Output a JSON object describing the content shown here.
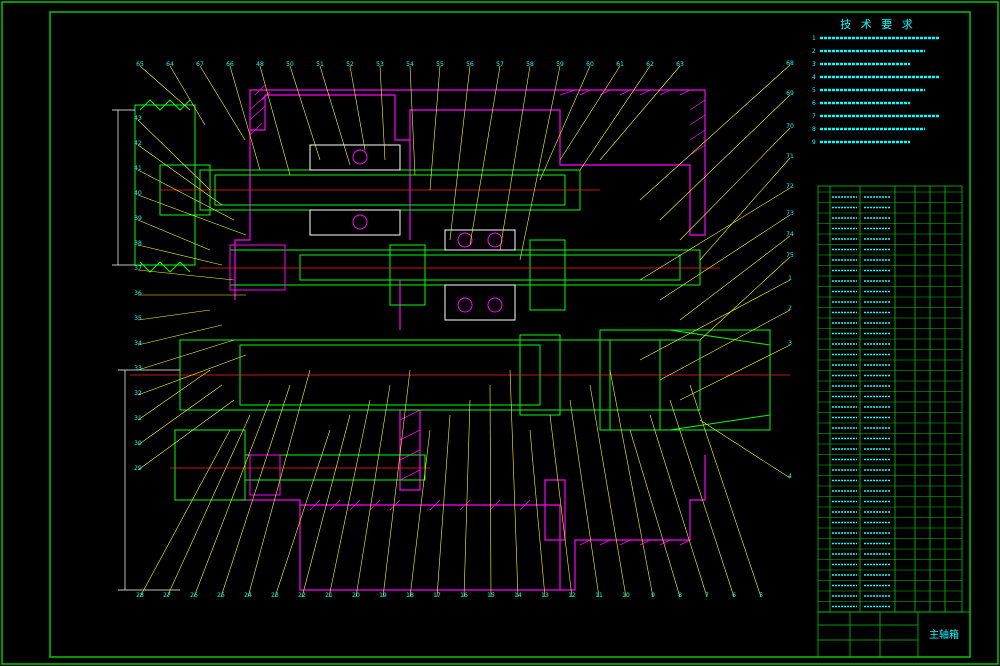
{
  "title_block": {
    "drawing_title": "主轴箱"
  },
  "notes": {
    "heading": "技 术 要 求",
    "items": [
      {
        "num": "1"
      },
      {
        "num": "2"
      },
      {
        "num": "3"
      },
      {
        "num": "4"
      },
      {
        "num": "5"
      },
      {
        "num": "6"
      },
      {
        "num": "7"
      },
      {
        "num": "8"
      },
      {
        "num": "9"
      }
    ]
  },
  "top_balloons": [
    "65",
    "64",
    "67",
    "66",
    "48",
    "50",
    "51",
    "52",
    "53",
    "54",
    "55",
    "56",
    "57",
    "58",
    "59",
    "60",
    "61",
    "62",
    "63"
  ],
  "right_balloons": [
    "68",
    "69",
    "70",
    "71",
    "72",
    "73",
    "74",
    "75",
    "1",
    "2",
    "3",
    "4"
  ],
  "bottom_balloons": [
    "28",
    "27",
    "26",
    "25",
    "24",
    "23",
    "22",
    "21",
    "20",
    "19",
    "18",
    "17",
    "16",
    "15",
    "14",
    "13",
    "12",
    "11",
    "10",
    "9",
    "8",
    "7",
    "6",
    "5"
  ],
  "left_balloons": [
    "43",
    "42",
    "41",
    "40",
    "39",
    "38",
    "37",
    "36",
    "35",
    "34",
    "33",
    "32",
    "31",
    "30",
    "29"
  ],
  "colors": {
    "frame": "#00c800",
    "geometry": "#00ff00",
    "hatch": "#ff00ff",
    "centerline": "#ff2020",
    "text": "#00ffff",
    "leader": "#ffff00",
    "white": "#ffffff"
  }
}
